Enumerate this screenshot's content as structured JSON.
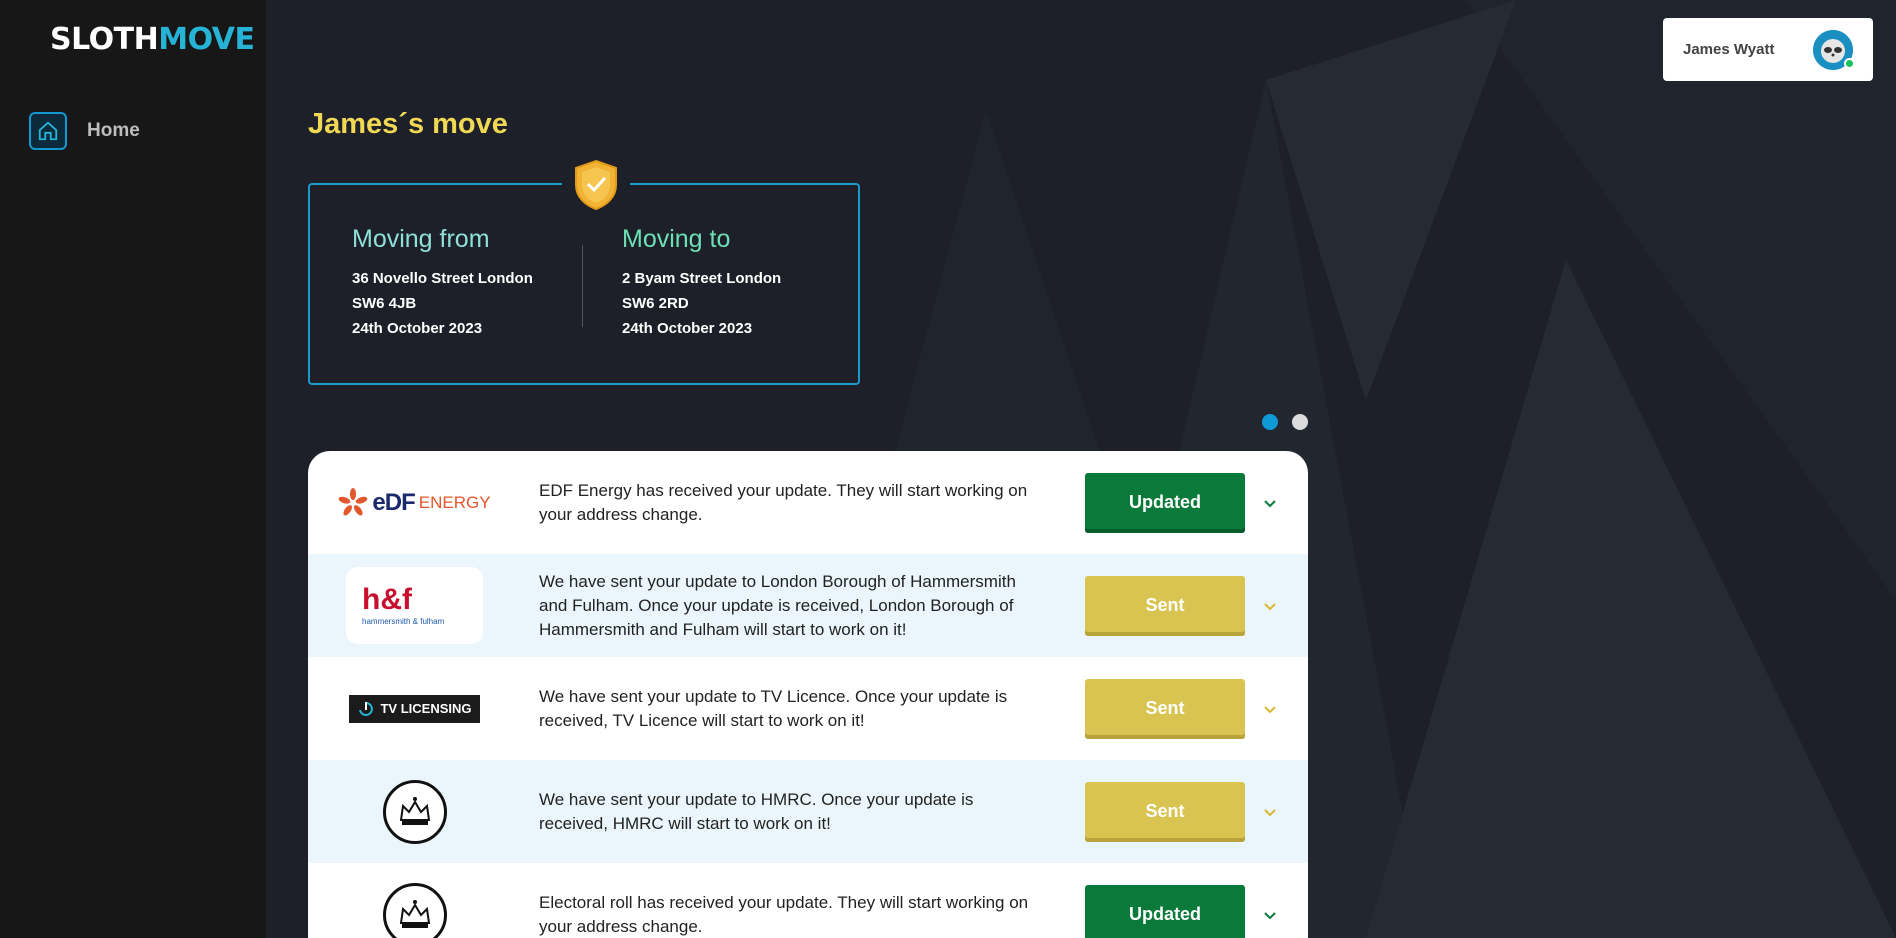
{
  "app": {
    "logo_part1": "SLOTH",
    "logo_part2": "MOVE"
  },
  "sidebar": {
    "items": [
      {
        "label": "Home",
        "icon": "home-icon"
      }
    ]
  },
  "user": {
    "name": "James Wyatt",
    "avatar_icon": "sloth-avatar-icon",
    "status_color": "#18c15b"
  },
  "page": {
    "title": "James´s move"
  },
  "move": {
    "from": {
      "heading": "Moving from",
      "line1": "36 Novello Street London",
      "line2": "SW6 4JB",
      "date": "24th October 2023"
    },
    "to": {
      "heading": "Moving to",
      "line1": "2 Byam Street London",
      "line2": "SW6 2RD",
      "date": "24th October 2023"
    }
  },
  "carousel": {
    "active_index": 0,
    "count": 2
  },
  "updates": [
    {
      "provider_logo": "edf-energy-logo",
      "logo_text": {
        "edf": "eDF",
        "energy": "ENERGY"
      },
      "message": "EDF Energy has received your update. They will start working on your address change.",
      "status": "Updated"
    },
    {
      "provider_logo": "hammersmith-fulham-logo",
      "logo_text": {
        "main": "h&f",
        "sub": "hammersmith & fulham"
      },
      "message": "We have sent your update to London Borough of Hammersmith and Fulham. Once your update is received, London Borough of Hammersmith and Fulham will start to work on it!",
      "status": "Sent"
    },
    {
      "provider_logo": "tv-licensing-logo",
      "logo_text": {
        "main": "TV LICENSING"
      },
      "message": "We have sent your update to TV Licence. Once your update is received, TV Licence will start to work on it!",
      "status": "Sent"
    },
    {
      "provider_logo": "hmrc-crown-logo",
      "message": "We have sent your update to HMRC. Once your update is received, HMRC will start to work on it!",
      "status": "Sent"
    },
    {
      "provider_logo": "electoral-roll-crown-logo",
      "message": "Electoral roll has received your update. They will start working on your address change.",
      "status": "Updated"
    }
  ],
  "colors": {
    "accent": "#1a9bd0",
    "title": "#f0d855",
    "updated": "#0a7a3a",
    "sent": "#d9c452"
  }
}
